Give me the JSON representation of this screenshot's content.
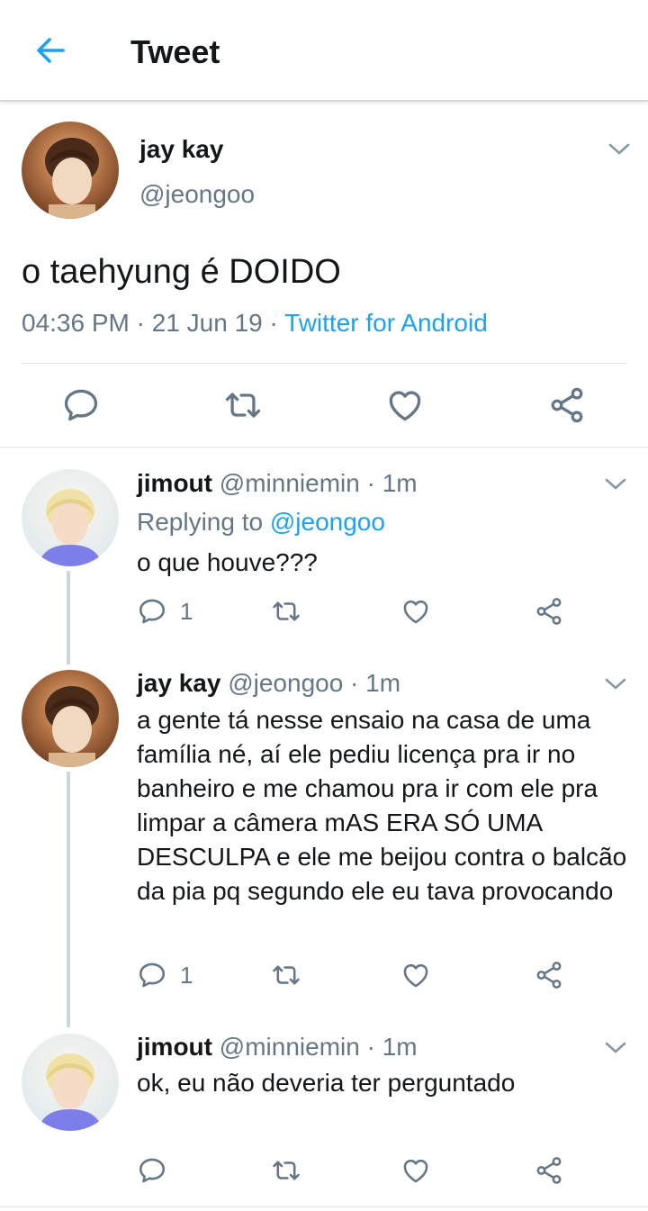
{
  "header": {
    "title": "Tweet"
  },
  "colors": {
    "accent": "#1da1f2",
    "secondary_text": "#657786",
    "thread_line": "#ccd6dd"
  },
  "main_tweet": {
    "name": "jay kay",
    "handle": "@jeongoo",
    "text": "o taehyung é DOIDO",
    "time": "04:36 PM",
    "date": "21 Jun 19",
    "source": "Twitter for Android",
    "separator": " · "
  },
  "replies": [
    {
      "name": "jimout",
      "handle": "@minniemin",
      "time": "1m",
      "replying_prefix": "Replying to",
      "replying_to": "@jeongoo",
      "text": "o que houve???",
      "reply_count": "1"
    },
    {
      "name": "jay kay",
      "handle": "@jeongoo",
      "time": "1m",
      "text": "a gente tá nesse ensaio na casa de uma família né, aí ele pediu licença pra ir no banheiro e me chamou pra ir com ele pra limpar a câmera mAS ERA SÓ UMA DESCULPA e ele me beijou contra o balcão da pia pq segundo ele eu tava provocando",
      "reply_count": "1"
    },
    {
      "name": "jimout",
      "handle": "@minniemin",
      "time": "1m",
      "text": "ok, eu não deveria ter perguntado",
      "reply_count": ""
    }
  ],
  "icons": [
    "back-arrow-icon",
    "chevron-down-icon",
    "reply-icon",
    "retweet-icon",
    "like-icon",
    "share-icon"
  ]
}
